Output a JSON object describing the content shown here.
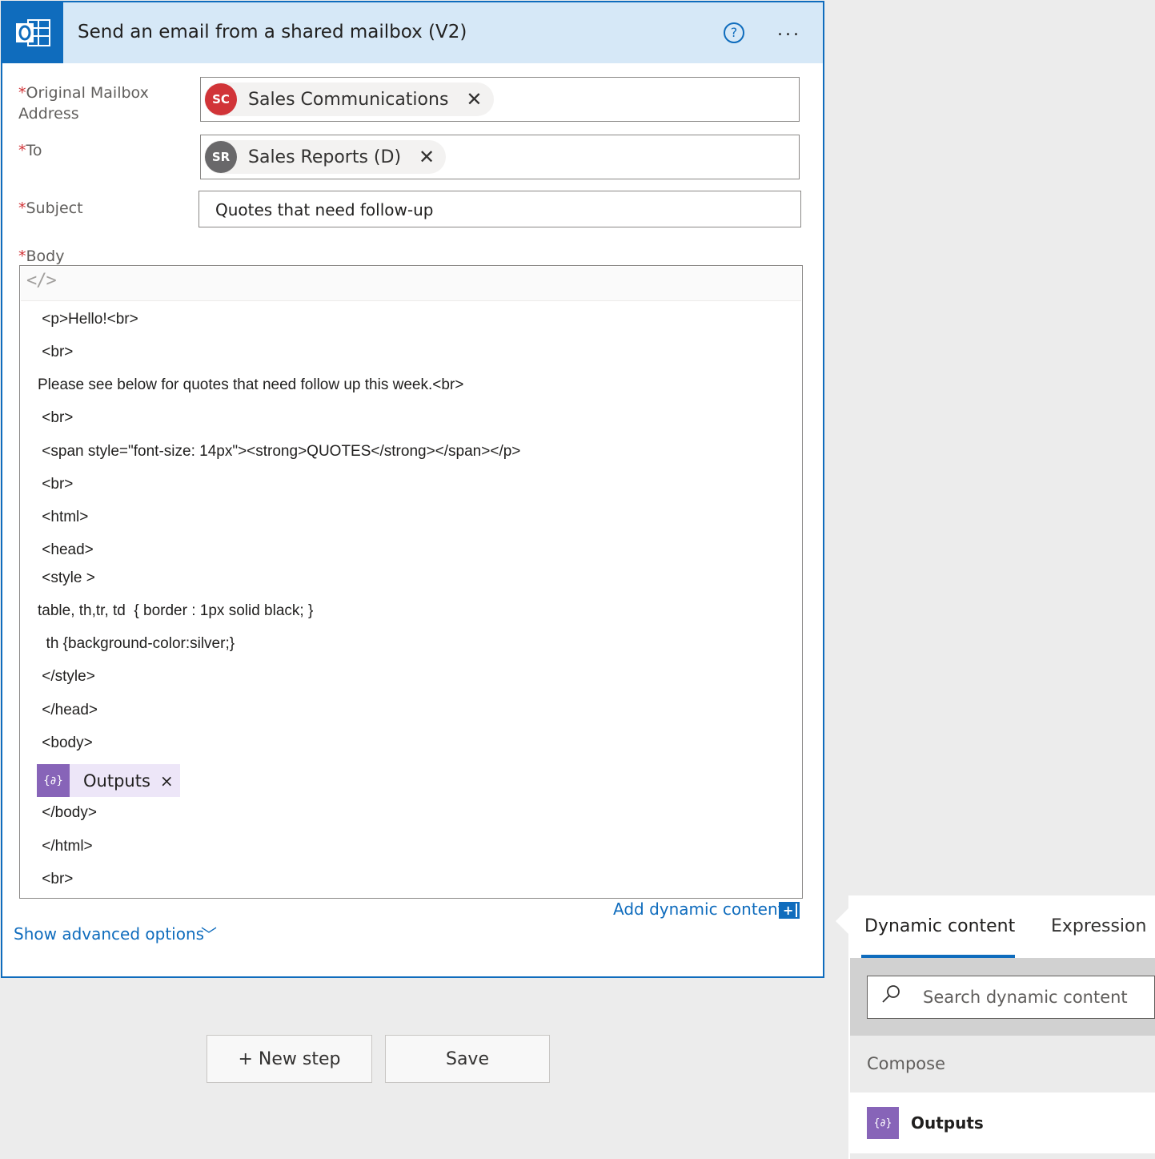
{
  "action": {
    "title": "Send an email from a shared mailbox (V2)",
    "help_glyph": "?",
    "more_glyph": "...",
    "app_icon": "outlook-icon"
  },
  "fields": {
    "required_marker": "*",
    "original_mailbox": {
      "label_line1": "Original Mailbox",
      "label_line2": "Address",
      "token_initials": "SC",
      "token_label": "Sales Communications",
      "token_color": "#d13438"
    },
    "to": {
      "label": "To",
      "token_initials": "SR",
      "token_label": "Sales Reports (D)",
      "token_color": "#69686a"
    },
    "subject": {
      "label": "Subject",
      "value": "Quotes that need follow-up"
    },
    "body": {
      "label": "Body",
      "code_icon": "</>",
      "lines": [
        " <p>Hello!<br>",
        " <br>",
        "Please see below for quotes that need follow up this week.<br>",
        " <br>",
        " <span style=\"font-size: 14px\"><strong>QUOTES</strong></span></p>",
        " <br>",
        " <html>",
        " <head>",
        " <style >",
        "table, th,tr, td  { border : 1px solid black; }",
        "  th {background-color:silver;}",
        " </style>",
        " </head>",
        " <body>",
        " </body>",
        " </html>",
        " <br>"
      ],
      "chip_icon": "{∂}",
      "chip_label": "Outputs",
      "chip_close": "×"
    }
  },
  "links": {
    "add_dynamic": "Add dynamic content",
    "add_dynamic_icon": "+",
    "show_advanced": "Show advanced options",
    "chevron": "﹀"
  },
  "buttons": {
    "new_step": "+ New step",
    "save": "Save"
  },
  "panel": {
    "tabs": [
      "Dynamic content",
      "Expression"
    ],
    "search_placeholder": "Search dynamic content",
    "search_icon_glyph": "⌕",
    "group": "Compose",
    "item_icon": "{∂}",
    "item_label": "Outputs"
  },
  "colors": {
    "accent": "#0f6cbd",
    "dynamic_purple": "#8764b8",
    "required_red": "#d13438"
  }
}
